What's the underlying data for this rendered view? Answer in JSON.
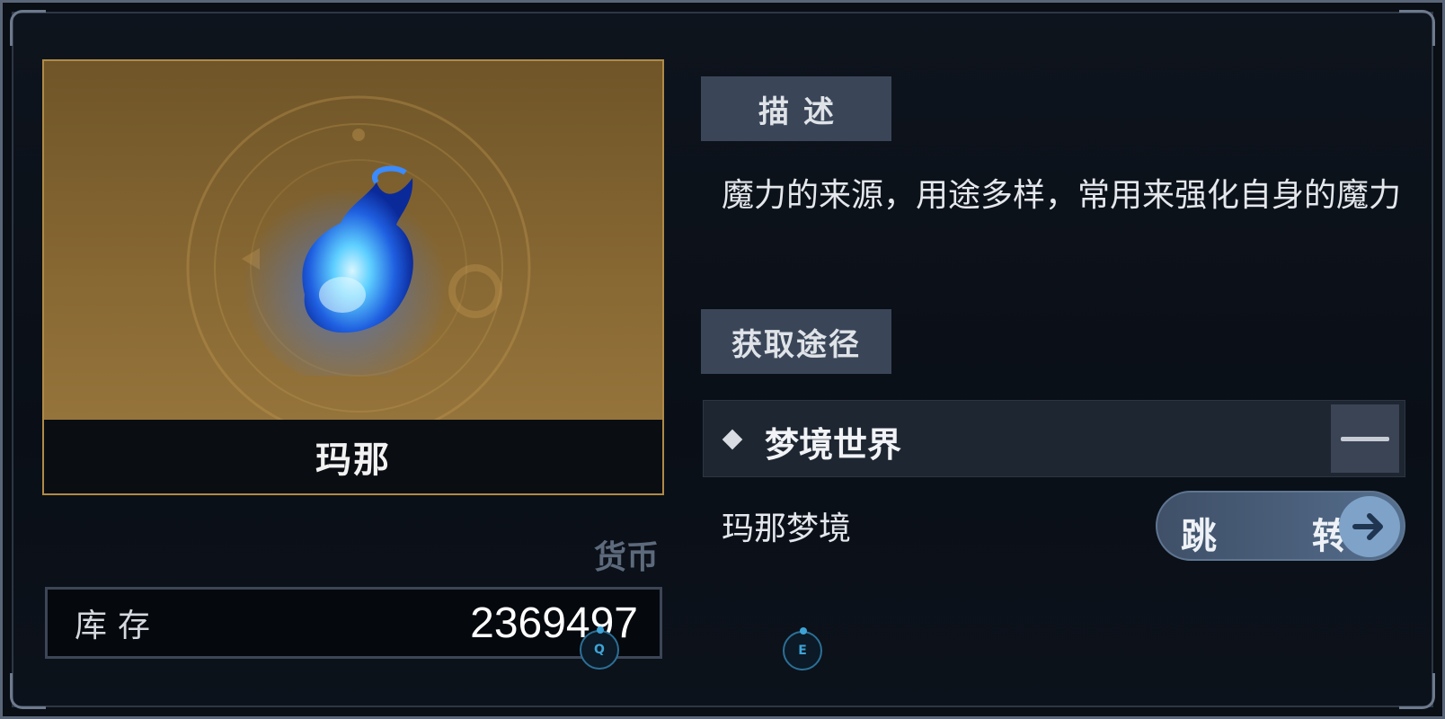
{
  "item": {
    "name": "玛那",
    "icon": "blue-flame-orb-icon",
    "category": "货币",
    "stock_label": "库存",
    "stock_value": "2369497"
  },
  "description": {
    "tab_label": "描述",
    "text": "魔力的来源，用途多样，常用来强化自身的魔力"
  },
  "sources": {
    "tab_label": "获取途径",
    "groups": [
      {
        "label": "梦境世界",
        "expanded": true,
        "items": [
          {
            "label": "玛那梦境",
            "action_label": "跳 转",
            "action_icon": "arrow-right-icon"
          }
        ]
      }
    ]
  },
  "key_hints": [
    {
      "key": "Q"
    },
    {
      "key": "E"
    }
  ],
  "colors": {
    "panel_bg": "#0b1018",
    "item_card_gold": "#8a6a34",
    "tab_bg": "#3a4658",
    "orb_blue": "#2f8cff"
  }
}
